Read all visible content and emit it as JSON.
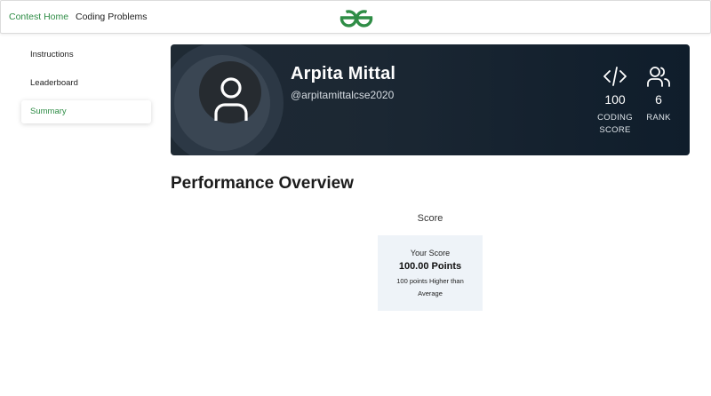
{
  "header": {
    "nav": [
      "Contest Home",
      "Coding Problems"
    ],
    "logo": "gfg-logo"
  },
  "sidebar": {
    "items": [
      {
        "label": "Instructions",
        "active": false
      },
      {
        "label": "Leaderboard",
        "active": false
      },
      {
        "label": "Summary",
        "active": true
      }
    ]
  },
  "profile": {
    "name": "Arpita Mittal",
    "handle": "@arpitamittalcse2020",
    "stats": [
      {
        "icon": "code-icon",
        "value": "100",
        "label_line1": "CODING",
        "label_line2": "SCORE"
      },
      {
        "icon": "users-icon",
        "value": "6",
        "label_line1": "RANK"
      }
    ]
  },
  "performance": {
    "heading": "Performance Overview",
    "score_title": "Score",
    "your_score_label": "Your Score",
    "points": "100.00 Points",
    "comparison_line1": "100 points Higher than",
    "comparison_line2": "Average"
  },
  "colors": {
    "accent": "#2f8d46",
    "card_bg": "#1b2733",
    "score_box_bg": "#eef3f8"
  }
}
